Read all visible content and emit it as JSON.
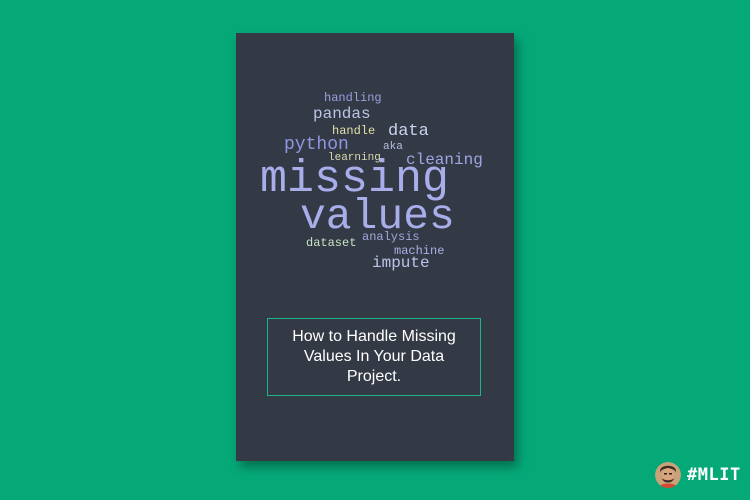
{
  "colors": {
    "background": "#05A978",
    "cover": "#343A45",
    "title_text": "#FFFFFF",
    "title_border": "#1FB38A",
    "tag_text": "#FFFFFF"
  },
  "cover": {
    "word_cloud": [
      {
        "text": "handling",
        "color": "#9A9FE0"
      },
      {
        "text": "pandas",
        "color": "#B8C5E6"
      },
      {
        "text": "handle",
        "color": "#E0E0A8"
      },
      {
        "text": "data",
        "color": "#C9D3EF"
      },
      {
        "text": "python",
        "color": "#8E96E3"
      },
      {
        "text": "aka",
        "color": "#B6BDE0"
      },
      {
        "text": "learning",
        "color": "#D9D9B0"
      },
      {
        "text": "cleaning",
        "color": "#9DA6E2"
      },
      {
        "text": "missing",
        "color": "#A7AEE9"
      },
      {
        "text": "values",
        "color": "#A7AEE9"
      },
      {
        "text": "analysis",
        "color": "#9FA7DC"
      },
      {
        "text": "dataset",
        "color": "#C7E3C3"
      },
      {
        "text": "machine",
        "color": "#A9AFE4"
      },
      {
        "text": "impute",
        "color": "#BBC2EA"
      }
    ],
    "title": "How to Handle Missing Values In Your Data Project."
  },
  "tag": {
    "text": "#MLIT",
    "avatar_icon": "avatar-icon"
  }
}
